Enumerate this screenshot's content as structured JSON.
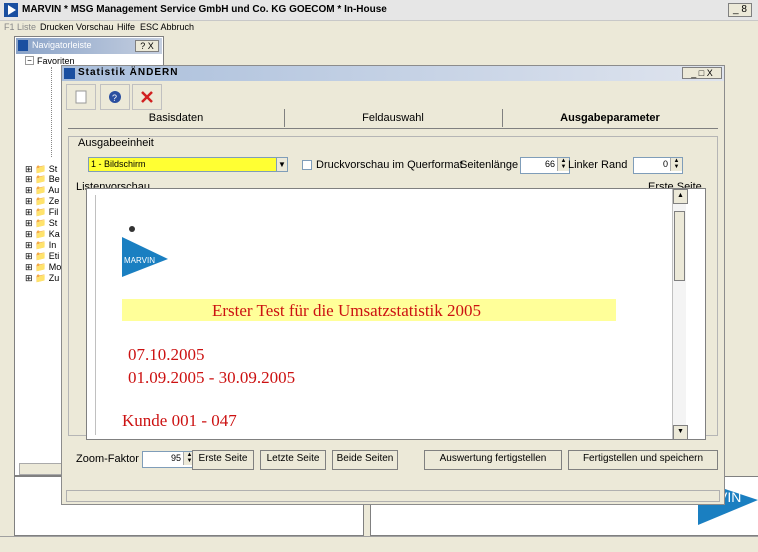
{
  "app": {
    "title": "MARVIN  * MSG Management Service GmbH und Co. KG GOECOM * In-House",
    "window_controls": "_ 8"
  },
  "menu": [
    "F1 Liste",
    "Drucken",
    "Vorschau",
    "Hilfe",
    "ESC Abbruch"
  ],
  "navigator": {
    "title": "Navigatorleiste",
    "title_controls": "? X",
    "favorites": "Favoriten",
    "items": [
      "St",
      "Be",
      "Au",
      "Ze",
      "Fil",
      "St",
      "Ka",
      "In",
      "Eti",
      "Mo",
      "Zu"
    ]
  },
  "dialog": {
    "title": "Statistik  ÄNDERN",
    "controls": "_ □ X",
    "tabs": [
      "Basisdaten",
      "Feldauswahl",
      "Ausgabeparameter"
    ],
    "group_label": "Ausgabeeinheit",
    "ausgabe_value": "1 - Bildschirm",
    "checkbox_label": "Druckvorschau im Querformat",
    "seitenlaenge_label": "Seitenlänge",
    "seitenlaenge_value": "66",
    "linker_rand_label": "Linker Rand",
    "linker_rand_value": "0",
    "listenvorschau_label": "Listenvorschau",
    "erste_seite_label": "Erste Seite",
    "zoom_label": "Zoom-Faktor",
    "zoom_value": "95",
    "buttons": {
      "erste": "Erste Seite",
      "letzte": "Letzte Seite",
      "beide": "Beide Seiten",
      "auswertung": "Auswertung fertigstellen",
      "fertig": "Fertigstellen und speichern"
    }
  },
  "preview": {
    "logo_text": "MARVIN",
    "heading": "Erster Test für die Umsatzstatistik 2005",
    "date": "07.10.2005",
    "range": "01.09.2005  -  30.09.2005",
    "kunde": "Kunde  001 - 047"
  },
  "bg_logo_text": "VIN",
  "colors": {
    "select_highlight": "#ffff33",
    "header_band": "#ffff99",
    "report_text": "#cc1111",
    "logo_blue": "#1a7fc1"
  }
}
